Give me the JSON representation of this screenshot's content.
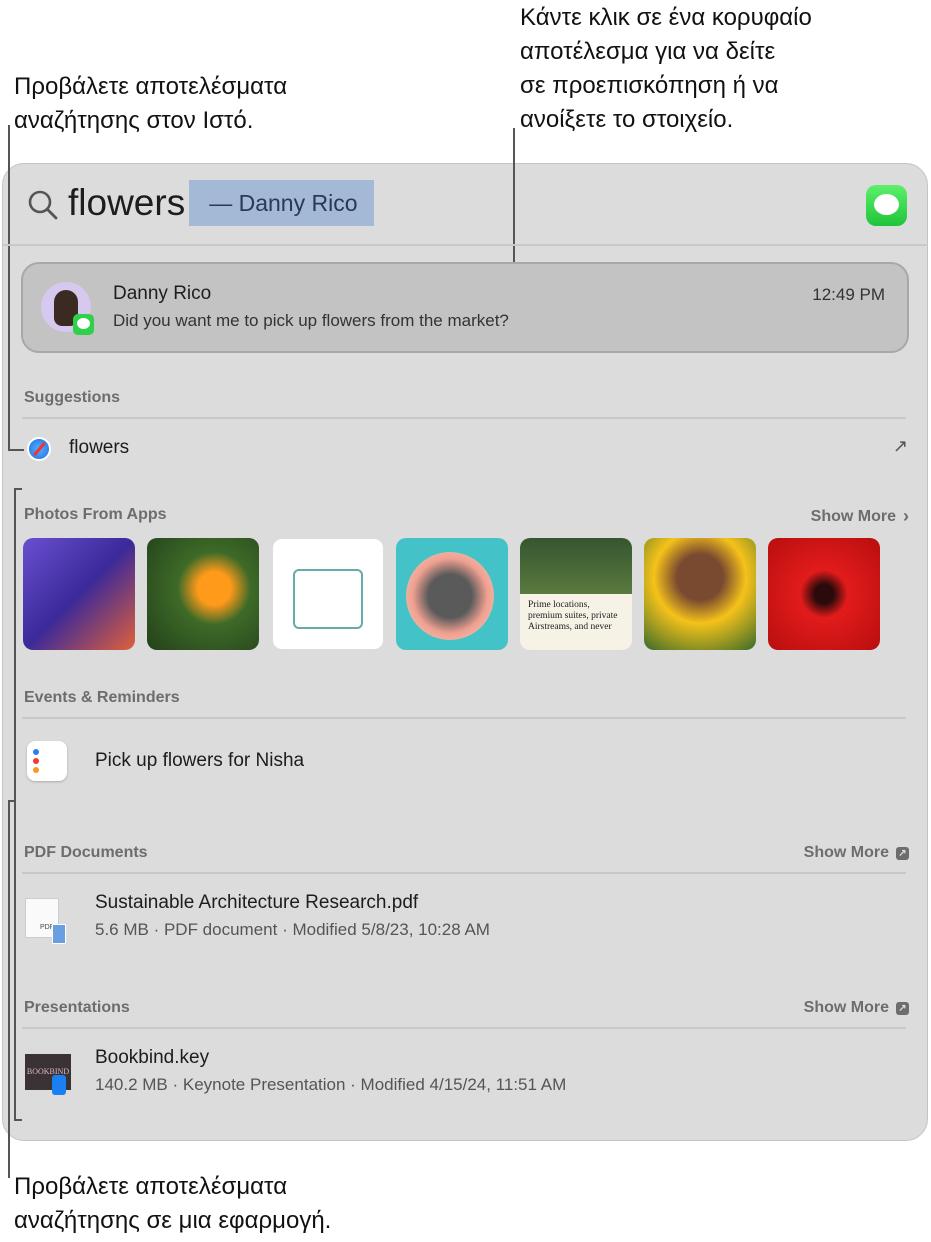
{
  "callouts": {
    "top_right": [
      "Κάντε κλικ σε ένα κορυφαίο",
      "αποτέλεσμα για να δείτε",
      "σε προεπισκόπηση ή να",
      "ανοίξετε το στοιχείο."
    ],
    "top_left": [
      "Προβάλετε αποτελέσματα",
      "αναζήτησης στον Ιστό."
    ],
    "bottom_left": [
      "Προβάλετε αποτελέσματα",
      "αναζήτησης σε μια εφαρμογή."
    ]
  },
  "search": {
    "query": "flowers",
    "completion": "— Danny Rico"
  },
  "top_hit": {
    "name": "Danny Rico",
    "message": "Did you want me to pick up flowers from the market?",
    "time": "12:49 PM"
  },
  "suggestions": {
    "header": "Suggestions",
    "items": [
      {
        "label": "flowers",
        "icon": "safari-icon"
      }
    ]
  },
  "photos": {
    "header": "Photos From Apps",
    "show_more": "Show More",
    "thumb_text": "Prime locations, premium suites, private Airstreams, and never"
  },
  "events": {
    "header": "Events & Reminders",
    "items": [
      {
        "title": "Pick up flowers for Nisha"
      }
    ]
  },
  "pdf": {
    "header": "PDF Documents",
    "show_more": "Show More",
    "items": [
      {
        "title": "Sustainable Architecture Research.pdf",
        "meta": "5.6 MB · PDF document · Modified 5/8/23, 10:28 AM",
        "badge": "PDF"
      }
    ]
  },
  "presentations": {
    "header": "Presentations",
    "show_more": "Show More",
    "items": [
      {
        "title": "Bookbind.key",
        "meta": "140.2 MB · Keynote Presentation · Modified 4/15/24, 11:51 AM",
        "thumb_text": "BOOKBIND"
      }
    ]
  }
}
